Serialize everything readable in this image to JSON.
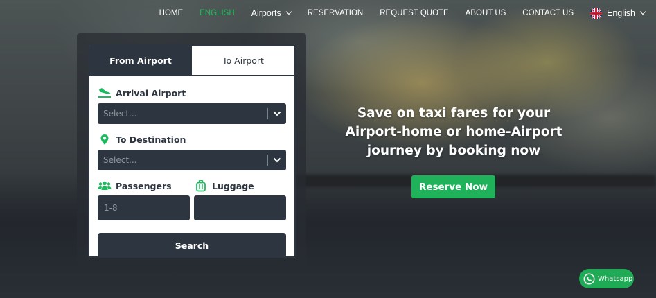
{
  "nav": {
    "items": [
      {
        "label": "HOME",
        "active": false
      },
      {
        "label": "ENGLISH",
        "active": true
      },
      {
        "label": "Airports",
        "active": false
      },
      {
        "label": "RESERVATION",
        "active": false
      },
      {
        "label": "REQUEST QUOTE",
        "active": false
      },
      {
        "label": "ABOUT US",
        "active": false
      },
      {
        "label": "CONTACT US",
        "active": false
      }
    ],
    "language": {
      "label": "English",
      "flag_icon": "uk-flag-icon"
    }
  },
  "booking": {
    "tabs": [
      {
        "label": "From Airport",
        "active": true
      },
      {
        "label": "To Airport",
        "active": false
      }
    ],
    "arrival_label": "Arrival Airport",
    "arrival_placeholder": "Select...",
    "destination_label": "To Destination",
    "destination_placeholder": "Select...",
    "passengers_label": "Passengers",
    "passengers_placeholder": "1-8",
    "luggage_label": "Luggage",
    "luggage_placeholder": "",
    "search_label": "Search"
  },
  "hero": {
    "title": "Save on taxi fares for your Airport-home or home-Airport journey by booking now",
    "cta_label": "Reserve Now"
  },
  "whatsapp": {
    "label": "Whatsapp"
  },
  "colors": {
    "accent": "#1dbb5f",
    "dark": "#2d3540",
    "white": "#ffffff"
  }
}
